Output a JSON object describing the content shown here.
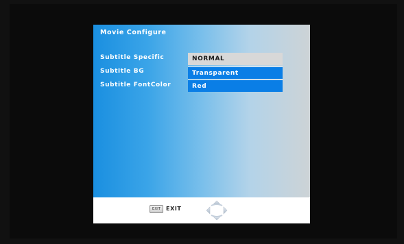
{
  "panel": {
    "title": "Movie Configure"
  },
  "settings": [
    {
      "label": "Subtitle Specific",
      "value": "NORMAL"
    },
    {
      "label": "Subtitle BG",
      "value": "Transparent"
    },
    {
      "label": "Subtitle FontColor",
      "value": "Red"
    }
  ],
  "footer": {
    "exit_key_label": "EXIT",
    "exit_label": "EXIT"
  },
  "icons": {
    "exit_key": "exit-key-icon",
    "navigation": "dpad-navigation-icon"
  },
  "colors": {
    "panel_left": "#1a8fe0",
    "panel_right": "#cdd3d6",
    "selected_option": "#d8d8d8",
    "option_highlight": "#0a7ee6",
    "background": "#111111"
  }
}
